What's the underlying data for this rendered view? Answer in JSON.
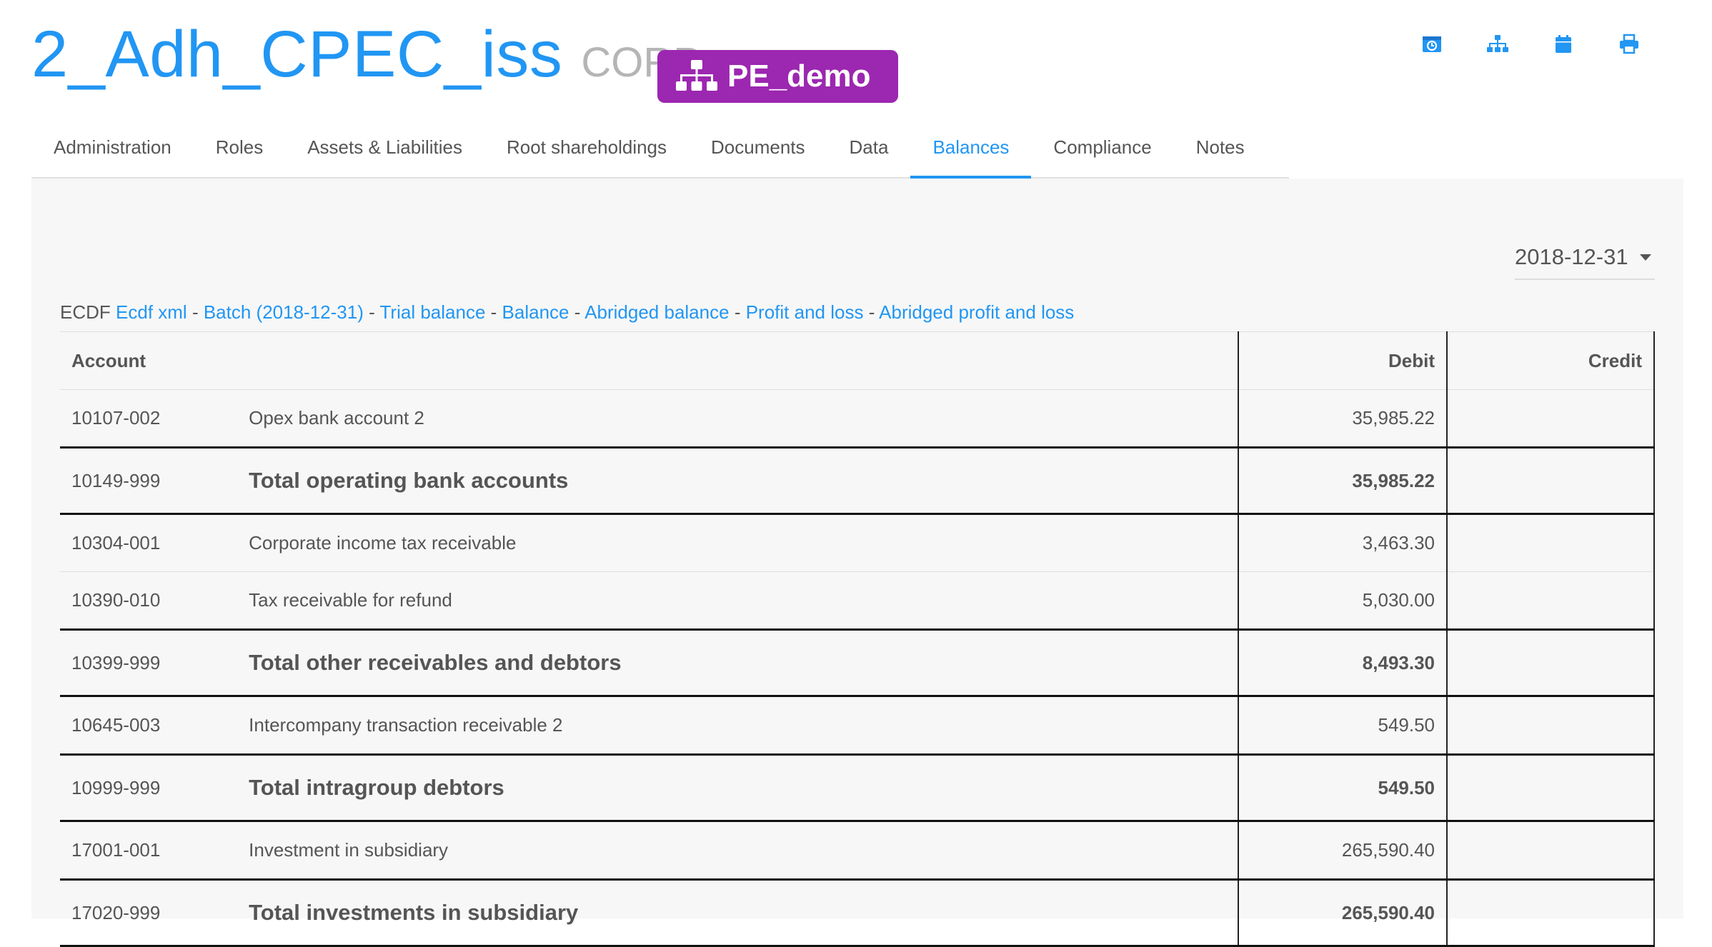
{
  "header": {
    "entity_name": "2_Adh_CPEC_iss",
    "entity_type": "CORP",
    "group_badge": {
      "label": "PE_demo",
      "icon": "sitemap-icon",
      "color": "#9c27b0"
    },
    "toolbar": [
      {
        "name": "ecdf-icon",
        "title": "ECDF"
      },
      {
        "name": "sitemap-icon",
        "title": "Structure"
      },
      {
        "name": "calendar-icon",
        "title": "Calendar"
      },
      {
        "name": "print-icon",
        "title": "Print"
      }
    ]
  },
  "tabs": [
    {
      "label": "Administration",
      "active": false
    },
    {
      "label": "Roles",
      "active": false
    },
    {
      "label": "Assets & Liabilities",
      "active": false
    },
    {
      "label": "Root shareholdings",
      "active": false
    },
    {
      "label": "Documents",
      "active": false
    },
    {
      "label": "Data",
      "active": false
    },
    {
      "label": "Balances",
      "active": true
    },
    {
      "label": "Compliance",
      "active": false
    },
    {
      "label": "Notes",
      "active": false
    }
  ],
  "balances": {
    "date_selected": "2018-12-31",
    "ecdf": {
      "prefix": "ECDF",
      "links": [
        "Ecdf xml",
        "Batch (2018-12-31)",
        "Trial balance",
        "Balance",
        "Abridged balance",
        "Profit and loss",
        "Abridged profit and loss"
      ],
      "separator": " - "
    },
    "table": {
      "headers": {
        "account": "Account",
        "debit": "Debit",
        "credit": "Credit"
      },
      "rows": [
        {
          "code": "10107-002",
          "description": "Opex bank account 2",
          "debit": "35,985.22",
          "credit": "",
          "total": false
        },
        {
          "code": "10149-999",
          "description": "Total operating bank accounts",
          "debit": "35,985.22",
          "credit": "",
          "total": true
        },
        {
          "code": "10304-001",
          "description": "Corporate income tax receivable",
          "debit": "3,463.30",
          "credit": "",
          "total": false
        },
        {
          "code": "10390-010",
          "description": "Tax receivable for refund",
          "debit": "5,030.00",
          "credit": "",
          "total": false
        },
        {
          "code": "10399-999",
          "description": "Total other receivables and debtors",
          "debit": "8,493.30",
          "credit": "",
          "total": true
        },
        {
          "code": "10645-003",
          "description": "Intercompany transaction receivable 2",
          "debit": "549.50",
          "credit": "",
          "total": false
        },
        {
          "code": "10999-999",
          "description": "Total intragroup debtors",
          "debit": "549.50",
          "credit": "",
          "total": true
        },
        {
          "code": "17001-001",
          "description": "Investment in subsidiary",
          "debit": "265,590.40",
          "credit": "",
          "total": false
        },
        {
          "code": "17020-999",
          "description": "Total investments in subsidiary",
          "debit": "265,590.40",
          "credit": "",
          "total": true
        }
      ]
    }
  },
  "colors": {
    "primary": "#2196f3",
    "badge": "#9c27b0",
    "muted": "#b5b5b5"
  }
}
